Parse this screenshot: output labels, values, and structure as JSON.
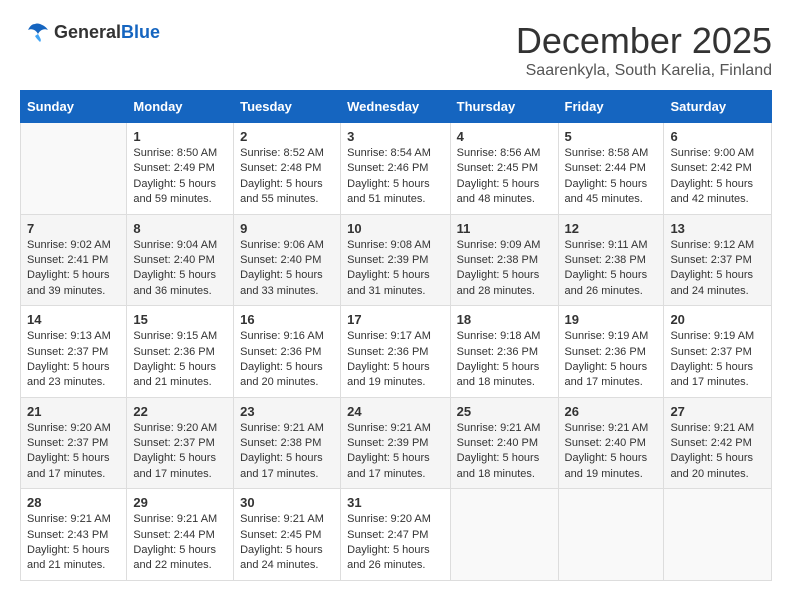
{
  "header": {
    "logo_general": "General",
    "logo_blue": "Blue",
    "month_title": "December 2025",
    "subtitle": "Saarenkyla, South Karelia, Finland"
  },
  "weekdays": [
    "Sunday",
    "Monday",
    "Tuesday",
    "Wednesday",
    "Thursday",
    "Friday",
    "Saturday"
  ],
  "weeks": [
    [
      {
        "day": "",
        "sunrise": "",
        "sunset": "",
        "daylight": ""
      },
      {
        "day": "1",
        "sunrise": "Sunrise: 8:50 AM",
        "sunset": "Sunset: 2:49 PM",
        "daylight": "Daylight: 5 hours and 59 minutes."
      },
      {
        "day": "2",
        "sunrise": "Sunrise: 8:52 AM",
        "sunset": "Sunset: 2:48 PM",
        "daylight": "Daylight: 5 hours and 55 minutes."
      },
      {
        "day": "3",
        "sunrise": "Sunrise: 8:54 AM",
        "sunset": "Sunset: 2:46 PM",
        "daylight": "Daylight: 5 hours and 51 minutes."
      },
      {
        "day": "4",
        "sunrise": "Sunrise: 8:56 AM",
        "sunset": "Sunset: 2:45 PM",
        "daylight": "Daylight: 5 hours and 48 minutes."
      },
      {
        "day": "5",
        "sunrise": "Sunrise: 8:58 AM",
        "sunset": "Sunset: 2:44 PM",
        "daylight": "Daylight: 5 hours and 45 minutes."
      },
      {
        "day": "6",
        "sunrise": "Sunrise: 9:00 AM",
        "sunset": "Sunset: 2:42 PM",
        "daylight": "Daylight: 5 hours and 42 minutes."
      }
    ],
    [
      {
        "day": "7",
        "sunrise": "Sunrise: 9:02 AM",
        "sunset": "Sunset: 2:41 PM",
        "daylight": "Daylight: 5 hours and 39 minutes."
      },
      {
        "day": "8",
        "sunrise": "Sunrise: 9:04 AM",
        "sunset": "Sunset: 2:40 PM",
        "daylight": "Daylight: 5 hours and 36 minutes."
      },
      {
        "day": "9",
        "sunrise": "Sunrise: 9:06 AM",
        "sunset": "Sunset: 2:40 PM",
        "daylight": "Daylight: 5 hours and 33 minutes."
      },
      {
        "day": "10",
        "sunrise": "Sunrise: 9:08 AM",
        "sunset": "Sunset: 2:39 PM",
        "daylight": "Daylight: 5 hours and 31 minutes."
      },
      {
        "day": "11",
        "sunrise": "Sunrise: 9:09 AM",
        "sunset": "Sunset: 2:38 PM",
        "daylight": "Daylight: 5 hours and 28 minutes."
      },
      {
        "day": "12",
        "sunrise": "Sunrise: 9:11 AM",
        "sunset": "Sunset: 2:38 PM",
        "daylight": "Daylight: 5 hours and 26 minutes."
      },
      {
        "day": "13",
        "sunrise": "Sunrise: 9:12 AM",
        "sunset": "Sunset: 2:37 PM",
        "daylight": "Daylight: 5 hours and 24 minutes."
      }
    ],
    [
      {
        "day": "14",
        "sunrise": "Sunrise: 9:13 AM",
        "sunset": "Sunset: 2:37 PM",
        "daylight": "Daylight: 5 hours and 23 minutes."
      },
      {
        "day": "15",
        "sunrise": "Sunrise: 9:15 AM",
        "sunset": "Sunset: 2:36 PM",
        "daylight": "Daylight: 5 hours and 21 minutes."
      },
      {
        "day": "16",
        "sunrise": "Sunrise: 9:16 AM",
        "sunset": "Sunset: 2:36 PM",
        "daylight": "Daylight: 5 hours and 20 minutes."
      },
      {
        "day": "17",
        "sunrise": "Sunrise: 9:17 AM",
        "sunset": "Sunset: 2:36 PM",
        "daylight": "Daylight: 5 hours and 19 minutes."
      },
      {
        "day": "18",
        "sunrise": "Sunrise: 9:18 AM",
        "sunset": "Sunset: 2:36 PM",
        "daylight": "Daylight: 5 hours and 18 minutes."
      },
      {
        "day": "19",
        "sunrise": "Sunrise: 9:19 AM",
        "sunset": "Sunset: 2:36 PM",
        "daylight": "Daylight: 5 hours and 17 minutes."
      },
      {
        "day": "20",
        "sunrise": "Sunrise: 9:19 AM",
        "sunset": "Sunset: 2:37 PM",
        "daylight": "Daylight: 5 hours and 17 minutes."
      }
    ],
    [
      {
        "day": "21",
        "sunrise": "Sunrise: 9:20 AM",
        "sunset": "Sunset: 2:37 PM",
        "daylight": "Daylight: 5 hours and 17 minutes."
      },
      {
        "day": "22",
        "sunrise": "Sunrise: 9:20 AM",
        "sunset": "Sunset: 2:37 PM",
        "daylight": "Daylight: 5 hours and 17 minutes."
      },
      {
        "day": "23",
        "sunrise": "Sunrise: 9:21 AM",
        "sunset": "Sunset: 2:38 PM",
        "daylight": "Daylight: 5 hours and 17 minutes."
      },
      {
        "day": "24",
        "sunrise": "Sunrise: 9:21 AM",
        "sunset": "Sunset: 2:39 PM",
        "daylight": "Daylight: 5 hours and 17 minutes."
      },
      {
        "day": "25",
        "sunrise": "Sunrise: 9:21 AM",
        "sunset": "Sunset: 2:40 PM",
        "daylight": "Daylight: 5 hours and 18 minutes."
      },
      {
        "day": "26",
        "sunrise": "Sunrise: 9:21 AM",
        "sunset": "Sunset: 2:40 PM",
        "daylight": "Daylight: 5 hours and 19 minutes."
      },
      {
        "day": "27",
        "sunrise": "Sunrise: 9:21 AM",
        "sunset": "Sunset: 2:42 PM",
        "daylight": "Daylight: 5 hours and 20 minutes."
      }
    ],
    [
      {
        "day": "28",
        "sunrise": "Sunrise: 9:21 AM",
        "sunset": "Sunset: 2:43 PM",
        "daylight": "Daylight: 5 hours and 21 minutes."
      },
      {
        "day": "29",
        "sunrise": "Sunrise: 9:21 AM",
        "sunset": "Sunset: 2:44 PM",
        "daylight": "Daylight: 5 hours and 22 minutes."
      },
      {
        "day": "30",
        "sunrise": "Sunrise: 9:21 AM",
        "sunset": "Sunset: 2:45 PM",
        "daylight": "Daylight: 5 hours and 24 minutes."
      },
      {
        "day": "31",
        "sunrise": "Sunrise: 9:20 AM",
        "sunset": "Sunset: 2:47 PM",
        "daylight": "Daylight: 5 hours and 26 minutes."
      },
      {
        "day": "",
        "sunrise": "",
        "sunset": "",
        "daylight": ""
      },
      {
        "day": "",
        "sunrise": "",
        "sunset": "",
        "daylight": ""
      },
      {
        "day": "",
        "sunrise": "",
        "sunset": "",
        "daylight": ""
      }
    ]
  ]
}
